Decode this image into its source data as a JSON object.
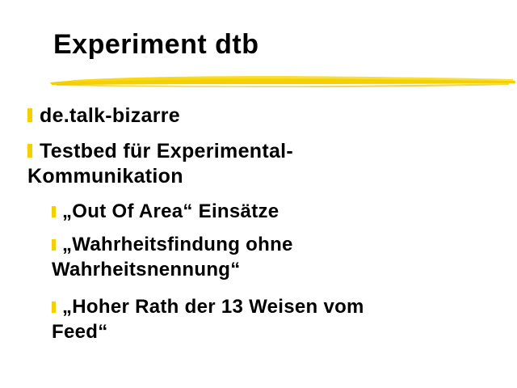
{
  "slide": {
    "title": "Experiment dtb",
    "accent_color": "#f5d000",
    "bullets": [
      {
        "level": 1,
        "text": "de.talk-bizarre"
      },
      {
        "level": 1,
        "text": "Testbed für Experimental-Kommunikation",
        "line1": "Testbed für Experimental-",
        "line2": "Kommunikation"
      },
      {
        "level": 2,
        "text": "„Out Of Area“ Einsätze"
      },
      {
        "level": 2,
        "text": "„Wahrheitsfindung ohne Wahrheitsnennung“",
        "line1": "„Wahrheitsfindung ohne",
        "line2": "Wahrheitsnennung“"
      },
      {
        "level": 2,
        "text": "„Hoher Rath der 13 Weisen vom Feed“",
        "line1": "„Hoher Rath der 13 Weisen vom",
        "line2": "Feed“"
      }
    ]
  }
}
